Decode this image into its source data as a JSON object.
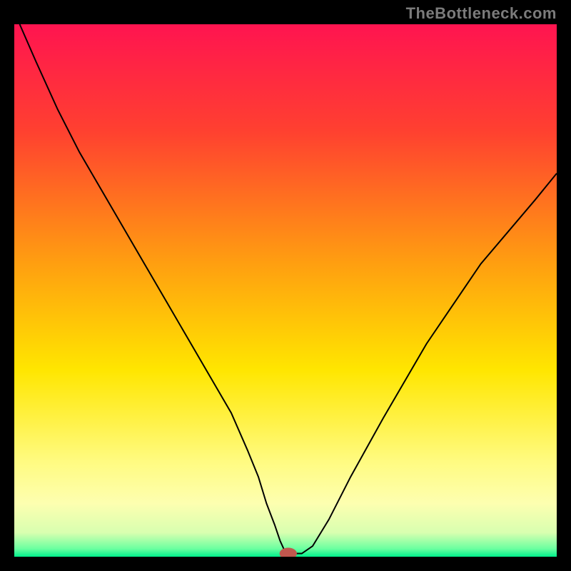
{
  "watermark": "TheBottleneck.com",
  "chart_data": {
    "type": "line",
    "title": "",
    "xlabel": "",
    "ylabel": "",
    "xlim": [
      0,
      100
    ],
    "ylim": [
      0,
      100
    ],
    "grid": false,
    "legend": false,
    "background_gradient_stops": [
      {
        "offset": 0.0,
        "color": "#ff1450"
      },
      {
        "offset": 0.2,
        "color": "#ff4030"
      },
      {
        "offset": 0.45,
        "color": "#ff9f10"
      },
      {
        "offset": 0.65,
        "color": "#ffe600"
      },
      {
        "offset": 0.82,
        "color": "#fffb80"
      },
      {
        "offset": 0.9,
        "color": "#fdffb0"
      },
      {
        "offset": 0.955,
        "color": "#d8ffb0"
      },
      {
        "offset": 0.985,
        "color": "#6bffa0"
      },
      {
        "offset": 1.0,
        "color": "#00f08c"
      }
    ],
    "series": [
      {
        "name": "bottleneck-curve",
        "stroke": "#000000",
        "x": [
          1,
          4,
          8,
          12,
          16,
          20,
          24,
          28,
          32,
          36,
          40,
          43,
          45,
          46.5,
          48,
          49,
          49.8,
          50.5,
          51.5,
          53,
          55,
          58,
          62,
          68,
          76,
          86,
          96,
          100
        ],
        "y": [
          100,
          93,
          84,
          76,
          69,
          62,
          55,
          48,
          41,
          34,
          27,
          20,
          15,
          10,
          6,
          3,
          1.2,
          0.6,
          0.6,
          0.6,
          2,
          7,
          15,
          26,
          40,
          55,
          67,
          72
        ]
      }
    ],
    "marker": {
      "name": "optimal-point",
      "x": 50.5,
      "y": 0.6,
      "rx": 1.6,
      "ry": 1.1,
      "color": "#c0574e"
    }
  }
}
